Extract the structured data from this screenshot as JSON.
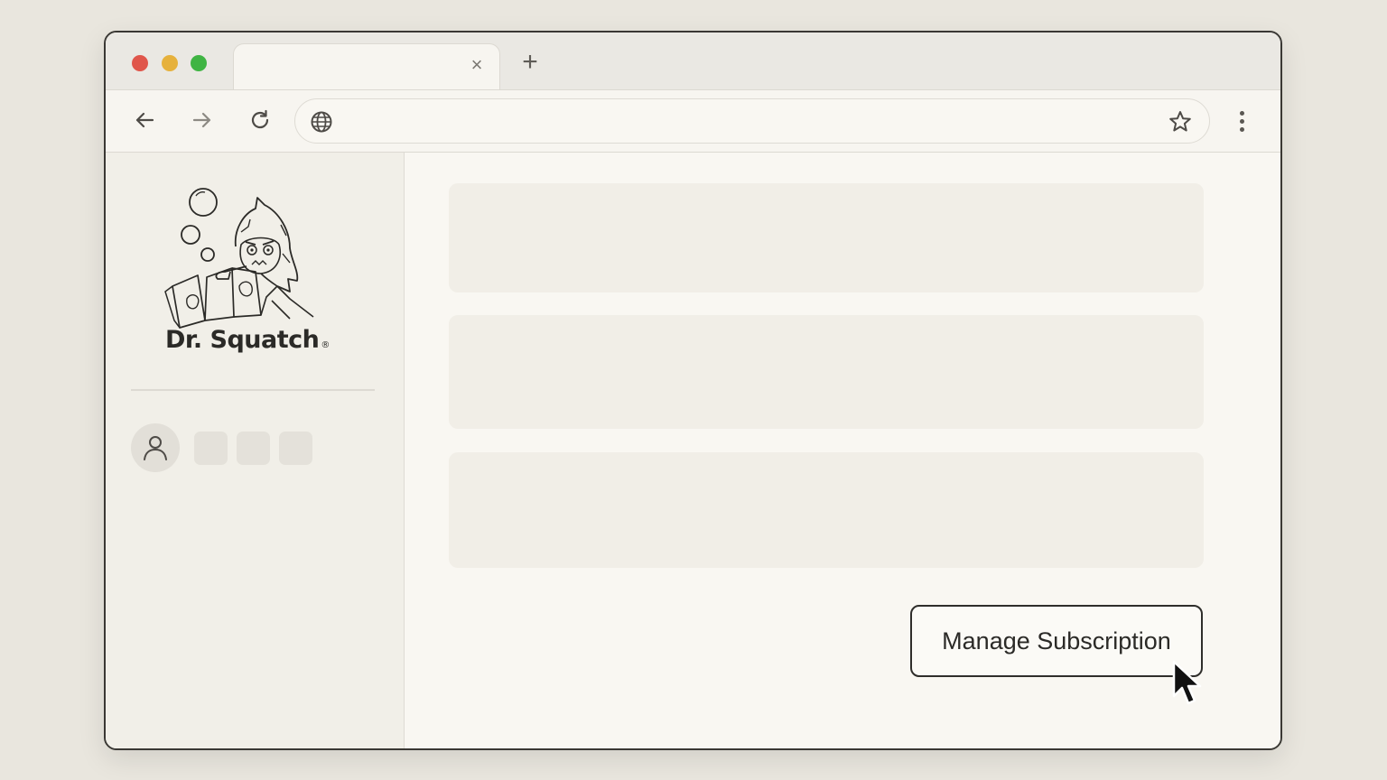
{
  "browser": {
    "tab": {
      "title": "",
      "close_glyph": "×"
    },
    "new_tab_glyph": "+",
    "address_bar": {
      "value": "",
      "placeholder": ""
    },
    "traffic_lights": {
      "close": "#e0564b",
      "minimize": "#e6b13c",
      "zoom": "#3fb443"
    },
    "icons": {
      "back": "arrow-left-icon",
      "forward": "arrow-right-icon",
      "reload": "reload-icon",
      "site": "globe-icon",
      "bookmark": "star-icon",
      "menu": "kebab-menu-icon"
    }
  },
  "sidebar": {
    "brand_name": "Dr. Squatch",
    "brand_mark": "®",
    "logo_icon": "sasquatch-reading-logo",
    "account_icon": "user-avatar-icon"
  },
  "main": {
    "manage_subscription_label": "Manage Subscription"
  },
  "colors": {
    "page_bg": "#e9e6de",
    "window_bg": "#f9f7f2",
    "sidebar_bg": "#f1efe8",
    "card_bg": "#f1eee7",
    "ink": "#2b2a27"
  }
}
